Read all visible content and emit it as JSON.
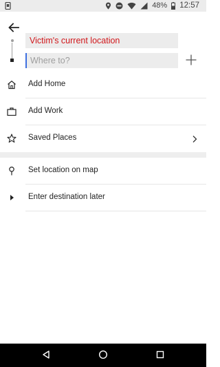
{
  "status_bar": {
    "battery_percent": "48%",
    "time": "12:57",
    "icons": [
      "sim-card-icon",
      "location-icon",
      "do-not-disturb-icon",
      "wifi-icon",
      "signal-icon",
      "battery-icon"
    ]
  },
  "header": {
    "back_icon": "arrow-left-icon",
    "pickup_text": "Victim's current location",
    "destination_placeholder": "Where to?",
    "destination_value": "",
    "add_stop_icon": "plus-icon",
    "pickup_color": "#d1171b"
  },
  "list": {
    "saved": [
      {
        "icon": "home-icon",
        "label": "Add Home"
      },
      {
        "icon": "briefcase-icon",
        "label": "Add Work"
      },
      {
        "icon": "star-icon",
        "label": "Saved Places",
        "chevron": "chevron-right-icon"
      }
    ],
    "actions": [
      {
        "icon": "map-pin-icon",
        "label": "Set location on map"
      },
      {
        "icon": "play-arrow-icon",
        "label": "Enter destination later"
      }
    ]
  },
  "nav_bar": {
    "icons": [
      "back-triangle-icon",
      "home-circle-icon",
      "recents-square-icon"
    ]
  }
}
